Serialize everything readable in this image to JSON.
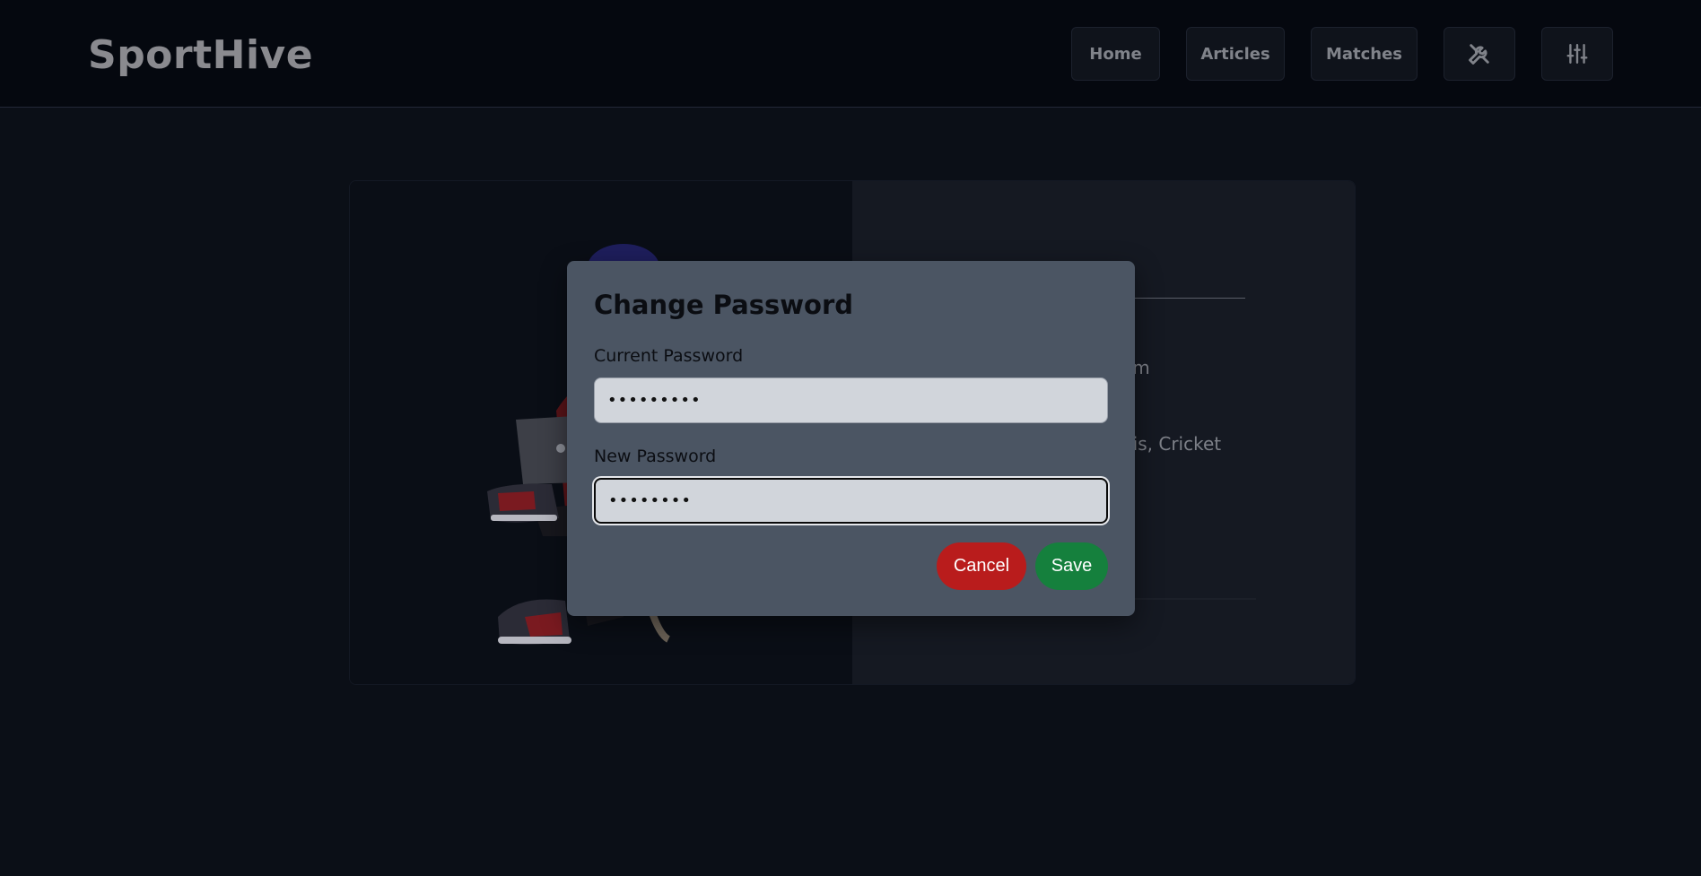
{
  "header": {
    "brand": "SportHive",
    "nav": {
      "home": "Home",
      "articles": "Articles",
      "matches": "Matches",
      "tools_icon": "tools-icon",
      "settings_icon": "sliders-icon"
    }
  },
  "profile": {
    "email_fragment": "om",
    "sports_fragment": "nis, Cricket"
  },
  "modal": {
    "title": "Change Password",
    "current_label": "Current Password",
    "current_value": "123456789",
    "new_label": "New Password",
    "new_value": "12345678",
    "cancel": "Cancel",
    "save": "Save"
  },
  "colors": {
    "cancel": "#b91c1c",
    "save": "#15803d",
    "modal_bg": "#4b5563"
  }
}
